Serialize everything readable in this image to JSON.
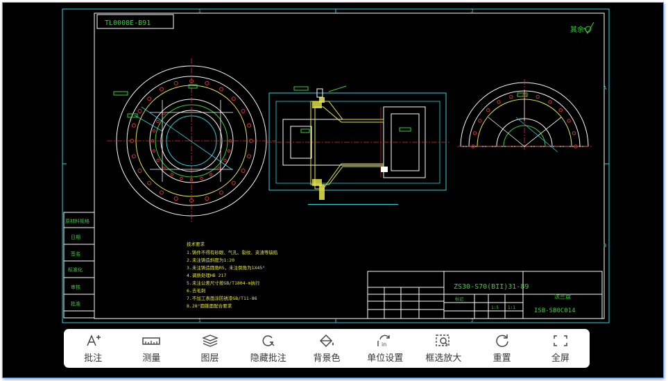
{
  "drawing": {
    "top_label": "TL0008E-B91",
    "surface_finish": "其余",
    "grid_cols": [
      "1",
      "2"
    ],
    "grid_rows": [
      "A",
      "B"
    ],
    "side_labels": [
      "原材料规格",
      "日期",
      "签名",
      "标准化",
      "审核",
      "批准"
    ],
    "notes": [
      "技术要求",
      "1.铸件不得有砂眼、气孔、裂纹、夹渣等缺陷",
      "2.未注铸造斜度为1:20",
      "3.未注铸造圆角R5，未注倒角为1X45°",
      "4.调质处理HB 217",
      "5.未注公差尺寸按GB/T1804-m执行",
      "6.去毛刺",
      "7.不加工表面涂防锈漆GB/T11-86",
      "8.28°圆锥面配合要求"
    ],
    "title_block": {
      "drawing_no": "ZS30-S70(BII)31-89",
      "part_name": "法兰盘",
      "code": "ISB-SB0C014",
      "cell_a": "标记",
      "cell_b": "1:5",
      "cell_c": "1:1"
    }
  },
  "toolbar": {
    "items": [
      {
        "name": "annotate",
        "label": "批注",
        "icon": "annotate-icon"
      },
      {
        "name": "measure",
        "label": "测量",
        "icon": "ruler-icon"
      },
      {
        "name": "layers",
        "label": "图层",
        "icon": "layers-icon"
      },
      {
        "name": "hide-annotations",
        "label": "隐藏批注",
        "icon": "hide-annotation-icon"
      },
      {
        "name": "background-color",
        "label": "背景色",
        "icon": "paint-bucket-icon"
      },
      {
        "name": "unit-settings",
        "label": "单位设置",
        "icon": "unit-icon"
      },
      {
        "name": "box-zoom",
        "label": "框选放大",
        "icon": "box-zoom-icon"
      },
      {
        "name": "reset",
        "label": "重置",
        "icon": "reset-icon"
      },
      {
        "name": "fullscreen",
        "label": "全屏",
        "icon": "fullscreen-icon"
      }
    ]
  },
  "colors": {
    "background": "#000000",
    "frame_line": "#2fd4e0",
    "center_line": "#e03030",
    "green": "#39d03a",
    "yellow": "#e8e84a",
    "white": "#ffffff",
    "toolbar_text": "#333333"
  }
}
